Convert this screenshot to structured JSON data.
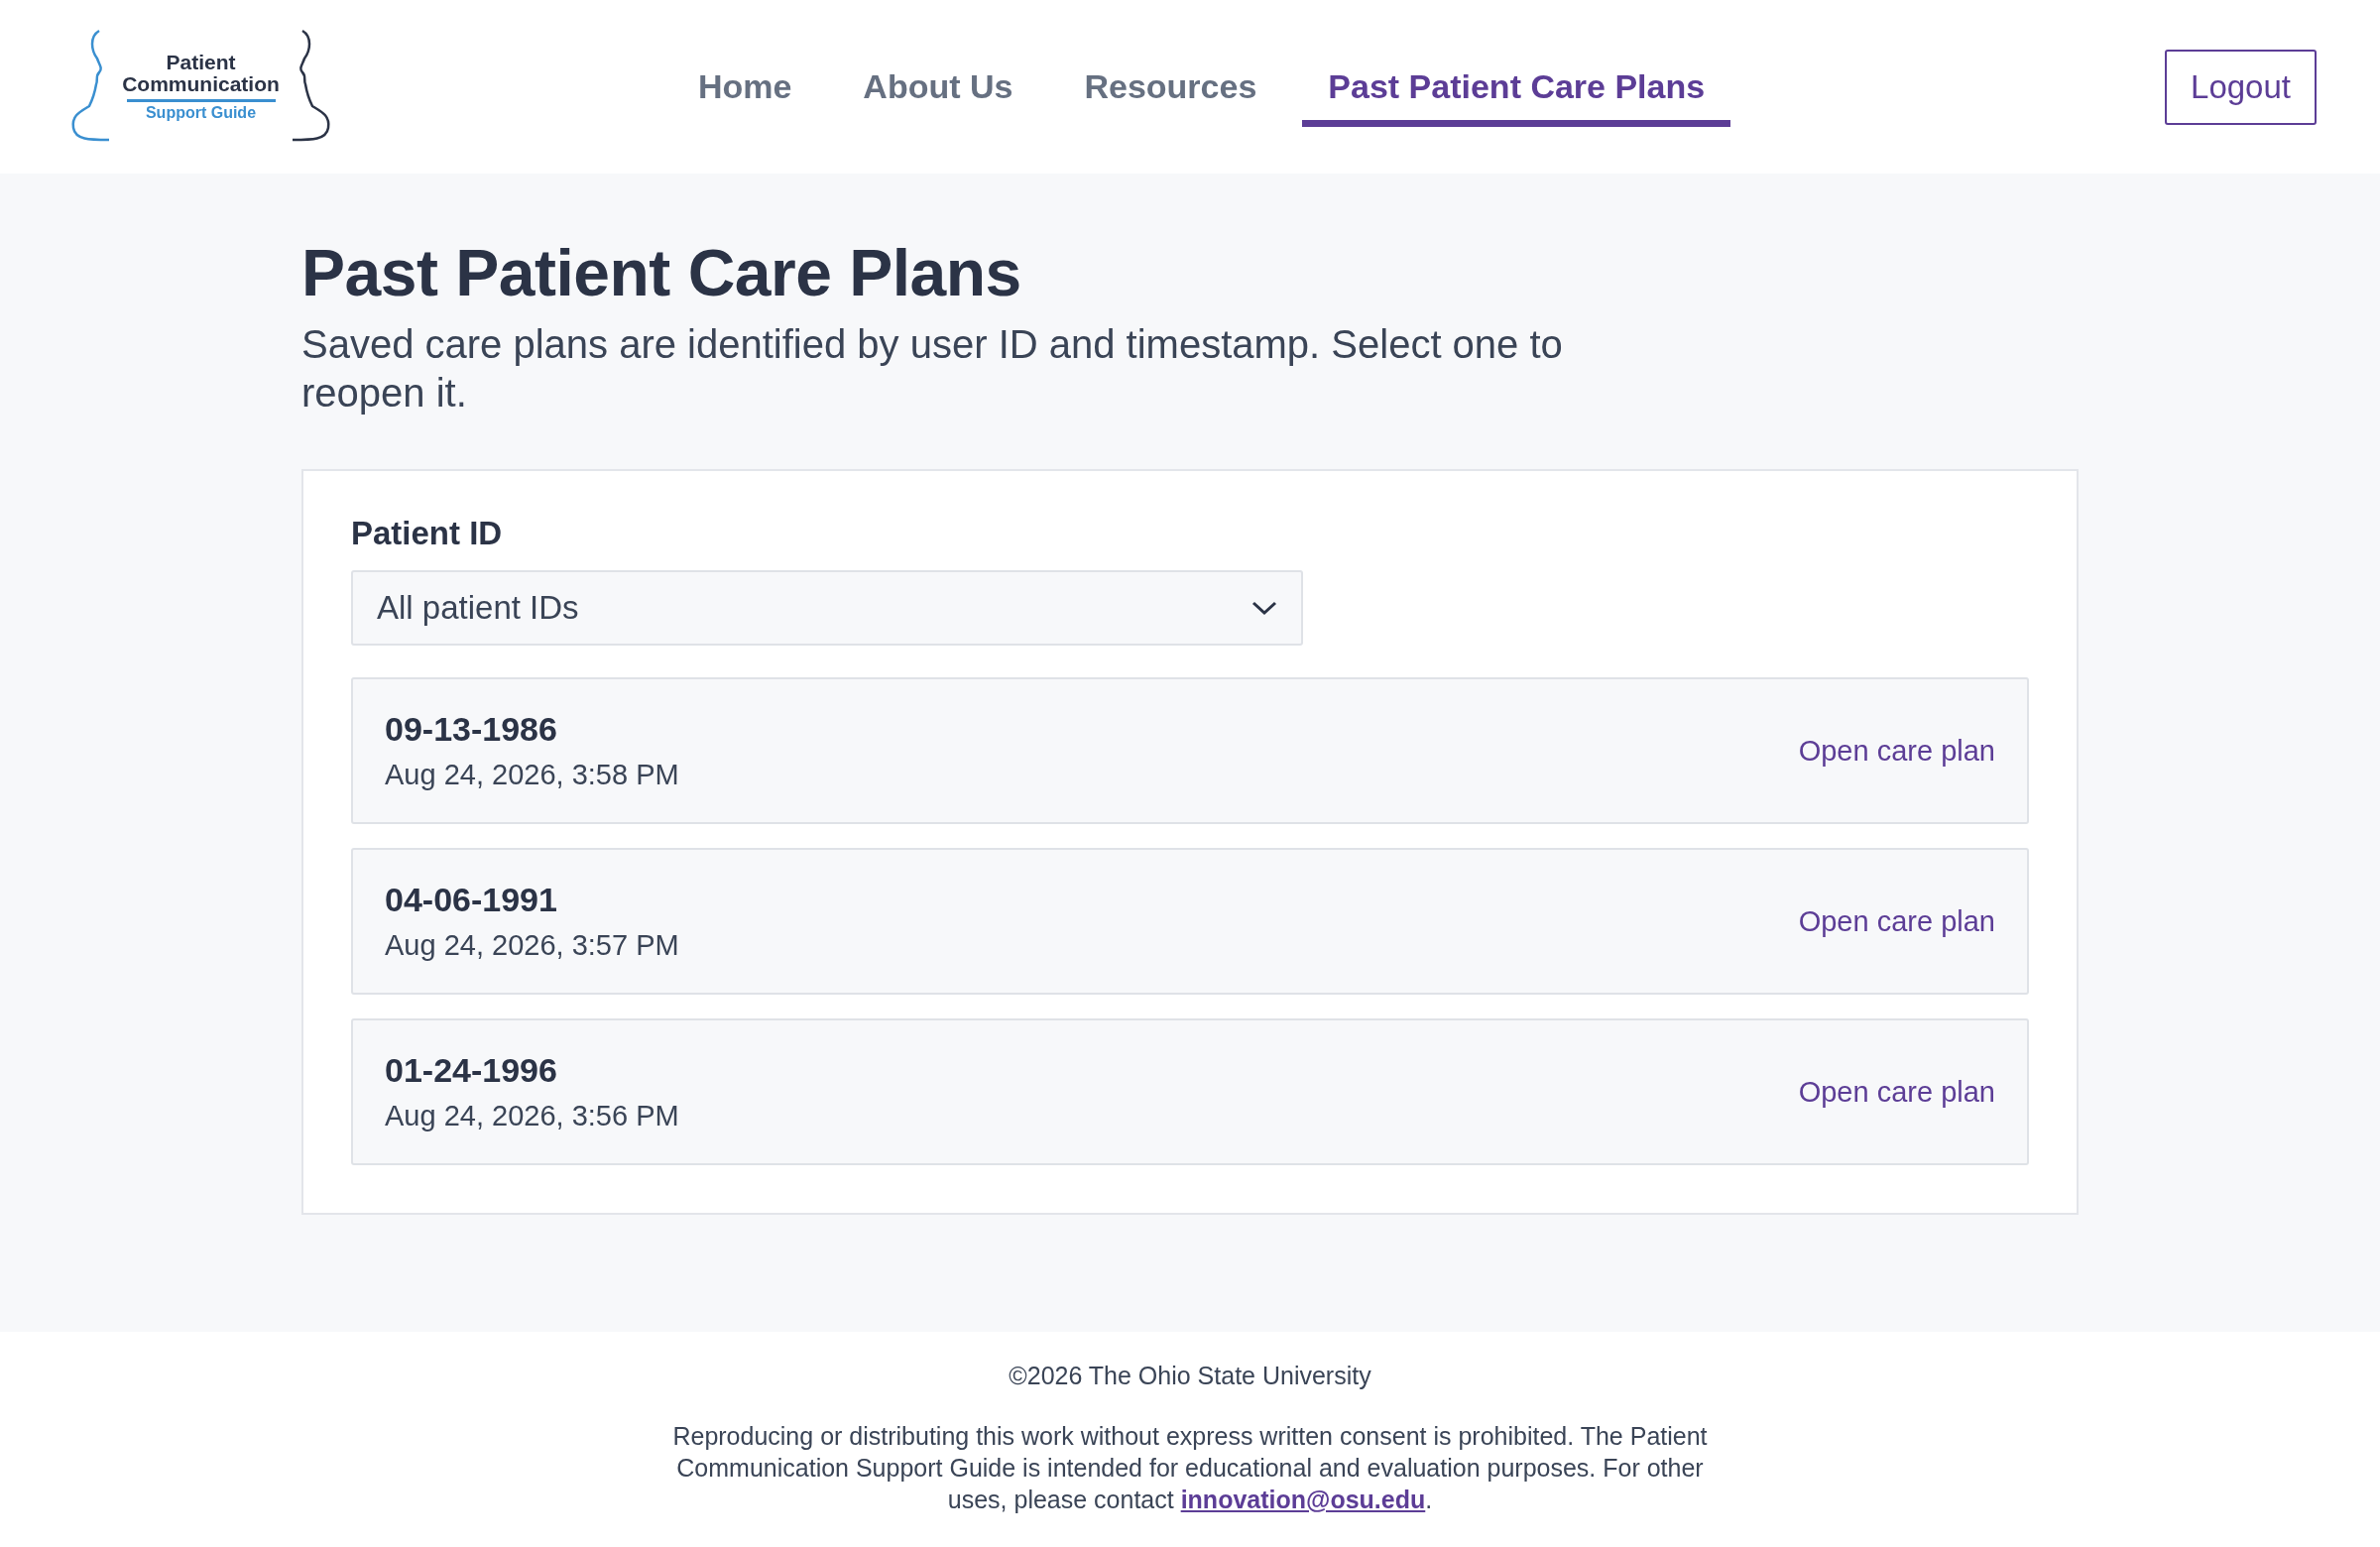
{
  "header": {
    "logo": {
      "line_1": "Patient",
      "line_2": "Communication",
      "line_3": "Support Guide"
    },
    "nav": [
      {
        "label": "Home",
        "selected": false
      },
      {
        "label": "About Us",
        "selected": false
      },
      {
        "label": "Resources",
        "selected": false
      },
      {
        "label": "Past Patient Care Plans",
        "selected": true
      }
    ],
    "logout": "Logout"
  },
  "page": {
    "title": "Past Patient Care Plans",
    "subtitle": "Saved care plans are identified by user ID and timestamp. Select one to reopen it."
  },
  "filter": {
    "label": "Patient ID",
    "value": "All patient IDs"
  },
  "plans": [
    {
      "patient_id": "09-13-1986",
      "timestamp": "Aug 24, 2026, 3:58 PM",
      "action": "Open care plan"
    },
    {
      "patient_id": "04-06-1991",
      "timestamp": "Aug 24, 2026, 3:57 PM",
      "action": "Open care plan"
    },
    {
      "patient_id": "01-24-1996",
      "timestamp": "Aug 24, 2026, 3:56 PM",
      "action": "Open care plan"
    }
  ],
  "footer": {
    "copyright": "©2026 The Ohio State University",
    "notice": "Reproducing or distributing this work without express written consent is prohibited. The Patient Communication Support Guide is intended for educational and evaluation purposes. For other uses, please contact ",
    "email": "innovation@osu.edu",
    "notice_end": "."
  }
}
